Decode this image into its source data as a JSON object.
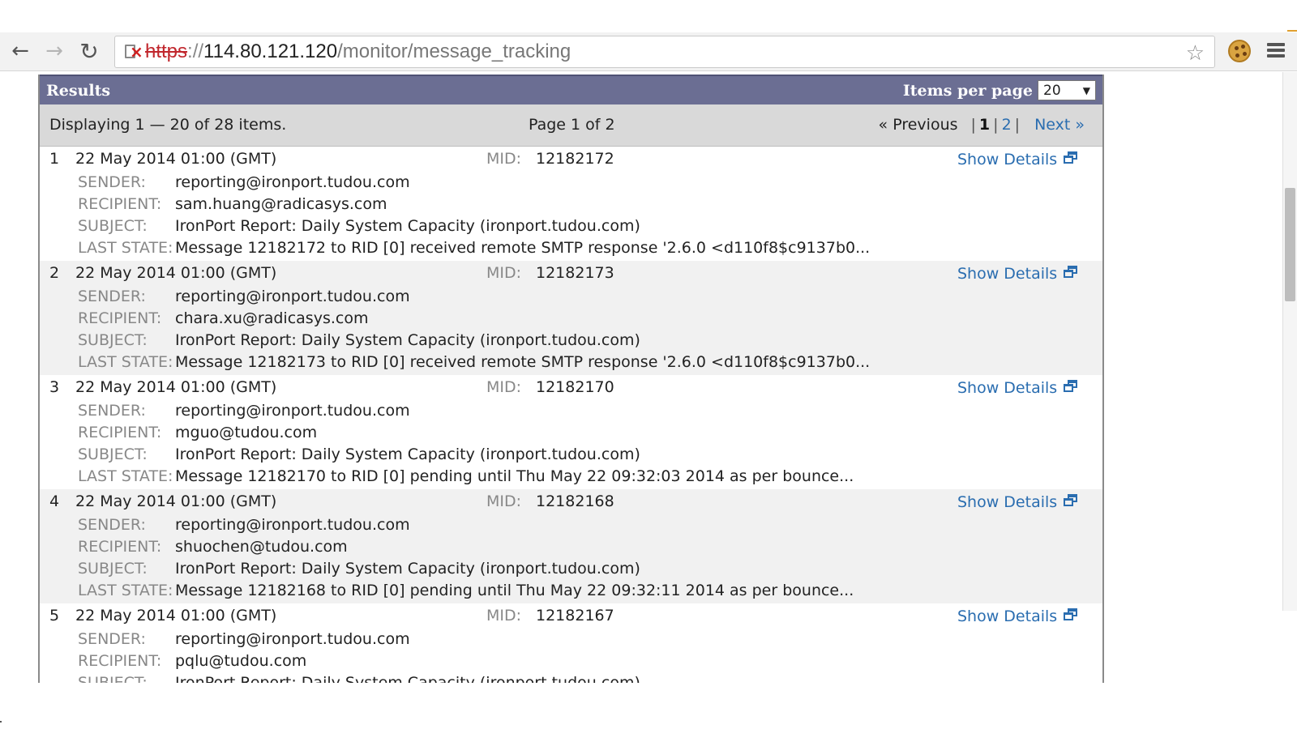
{
  "browser": {
    "url_scheme": "https",
    "url_sep": "://",
    "url_host": "114.80.121.120",
    "url_path": "/monitor/message_tracking"
  },
  "results": {
    "title": "Results",
    "items_per_page_label": "Items per page",
    "items_per_page_value": "20",
    "displaying": "Displaying 1 — 20 of 28 items.",
    "page_of": "Page 1 of 2",
    "prev": "«  Previous",
    "current_page": "1",
    "page_2": "2",
    "next": "Next  »"
  },
  "labels": {
    "mid": "MID:",
    "sender": "SENDER:",
    "recipient": "RECIPIENT:",
    "subject": "SUBJECT:",
    "last_state": "LAST STATE:",
    "show_details": "Show Details"
  },
  "messages": [
    {
      "num": "1",
      "date": "22 May 2014 01:00 (GMT)",
      "mid": "12182172",
      "sender": "reporting@ironport.tudou.com",
      "recipient": "sam.huang@radicasys.com",
      "subject": "IronPort Report: Daily System Capacity (ironport.tudou.com)",
      "last_state": "Message 12182172 to RID [0] received remote SMTP response '2.6.0 <d110f8$c9137b0..."
    },
    {
      "num": "2",
      "date": "22 May 2014 01:00 (GMT)",
      "mid": "12182173",
      "sender": "reporting@ironport.tudou.com",
      "recipient": "chara.xu@radicasys.com",
      "subject": "IronPort Report: Daily System Capacity (ironport.tudou.com)",
      "last_state": "Message 12182173 to RID [0] received remote SMTP response '2.6.0 <d110f8$c9137b0..."
    },
    {
      "num": "3",
      "date": "22 May 2014 01:00 (GMT)",
      "mid": "12182170",
      "sender": "reporting@ironport.tudou.com",
      "recipient": "mguo@tudou.com",
      "subject": "IronPort Report: Daily System Capacity (ironport.tudou.com)",
      "last_state": "Message 12182170 to RID [0] pending until Thu May 22 09:32:03 2014 as per bounce..."
    },
    {
      "num": "4",
      "date": "22 May 2014 01:00 (GMT)",
      "mid": "12182168",
      "sender": "reporting@ironport.tudou.com",
      "recipient": "shuochen@tudou.com",
      "subject": "IronPort Report: Daily System Capacity (ironport.tudou.com)",
      "last_state": "Message 12182168 to RID [0] pending until Thu May 22 09:32:11 2014 as per bounce..."
    },
    {
      "num": "5",
      "date": "22 May 2014 01:00 (GMT)",
      "mid": "12182167",
      "sender": "reporting@ironport.tudou.com",
      "recipient": "pqlu@tudou.com",
      "subject": "IronPort Report: Daily System Capacity (ironport.tudou.com)",
      "last_state": ""
    }
  ]
}
